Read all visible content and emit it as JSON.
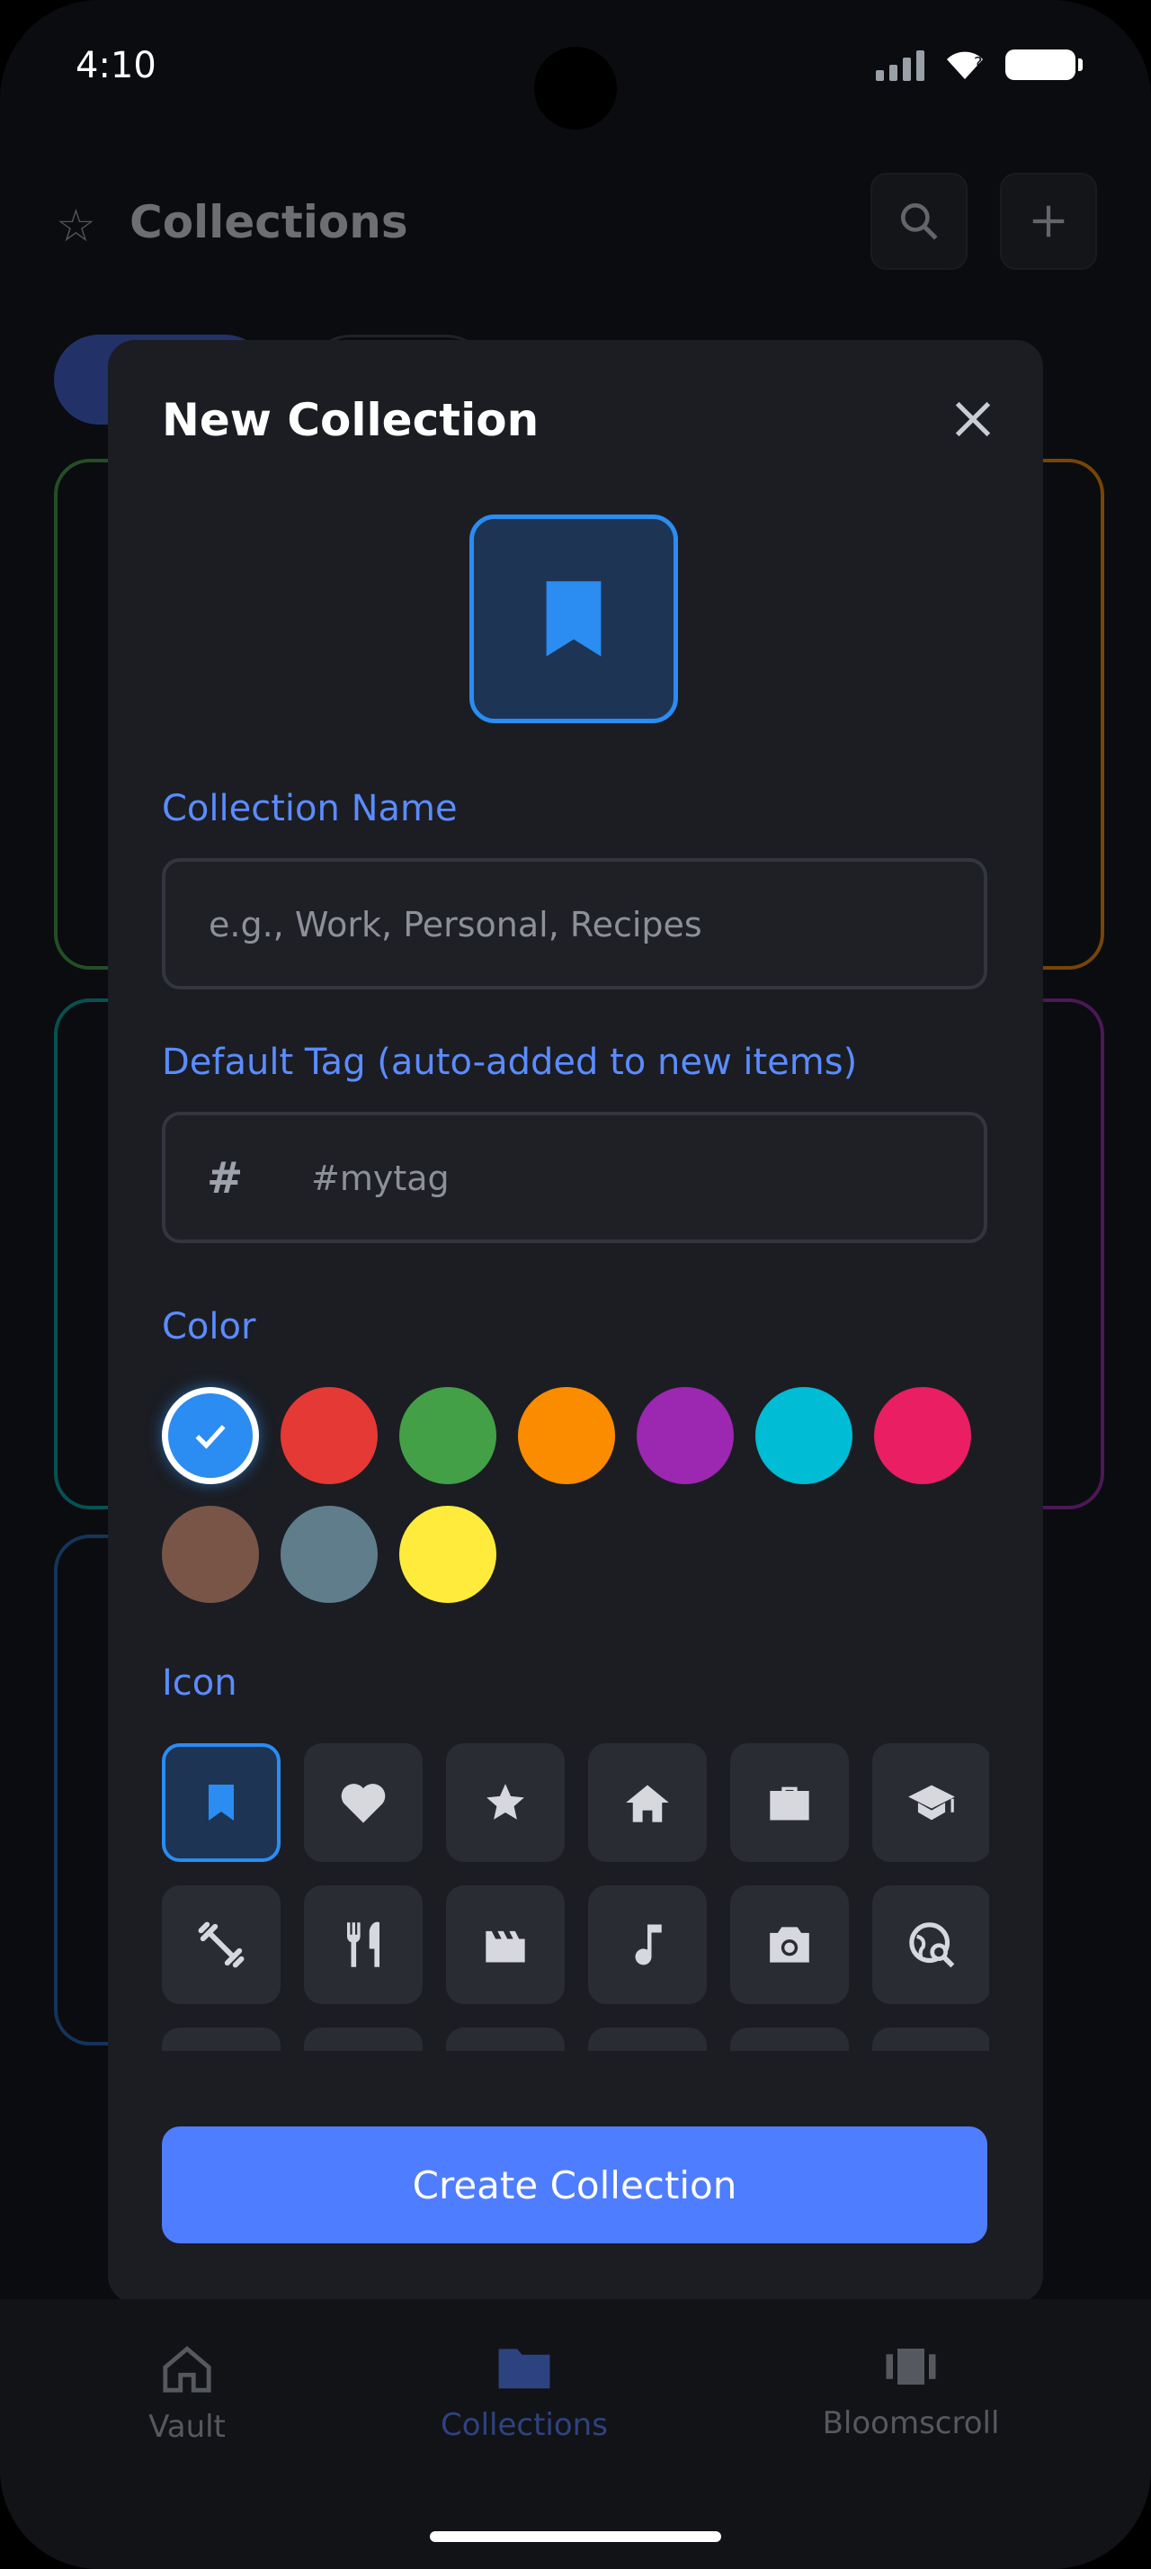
{
  "status": {
    "time": "4:10"
  },
  "header": {
    "title": "Collections",
    "star_icon": "star-outline-icon",
    "search_icon": "search-icon",
    "add_icon": "plus-icon"
  },
  "modal": {
    "title": "New Collection",
    "close_icon": "close-icon",
    "preview_icon": "bookmark-icon",
    "name_label": "Collection Name",
    "name_placeholder": "e.g., Work, Personal, Recipes",
    "tag_label": "Default Tag (auto-added to new items)",
    "tag_placeholder": "#mytag",
    "tag_prefix": "#",
    "color_label": "Color",
    "colors": [
      "#2b8cf2",
      "#e53935",
      "#43a047",
      "#fb8c00",
      "#9c27b0",
      "#00bcd4",
      "#e91e63",
      "#795548",
      "#607d8b",
      "#ffeb3b"
    ],
    "selected_color": "#2b8cf2",
    "icon_label": "Icon",
    "icons": [
      "bookmark-icon",
      "heart-icon",
      "star-icon",
      "home-icon",
      "briefcase-icon",
      "graduation-cap-icon",
      "fitness-icon",
      "restaurant-icon",
      "movie-icon",
      "music-note-icon",
      "camera-icon",
      "travel-explore-icon"
    ],
    "selected_icon": "bookmark-icon",
    "create_label": "Create Collection",
    "accent": "#4f7dff"
  },
  "bottom_nav": {
    "items": [
      {
        "label": "Vault",
        "icon": "home-icon"
      },
      {
        "label": "Collections",
        "icon": "folder-icon"
      },
      {
        "label": "Bloomscroll",
        "icon": "carousel-icon"
      }
    ],
    "active": "Collections"
  }
}
